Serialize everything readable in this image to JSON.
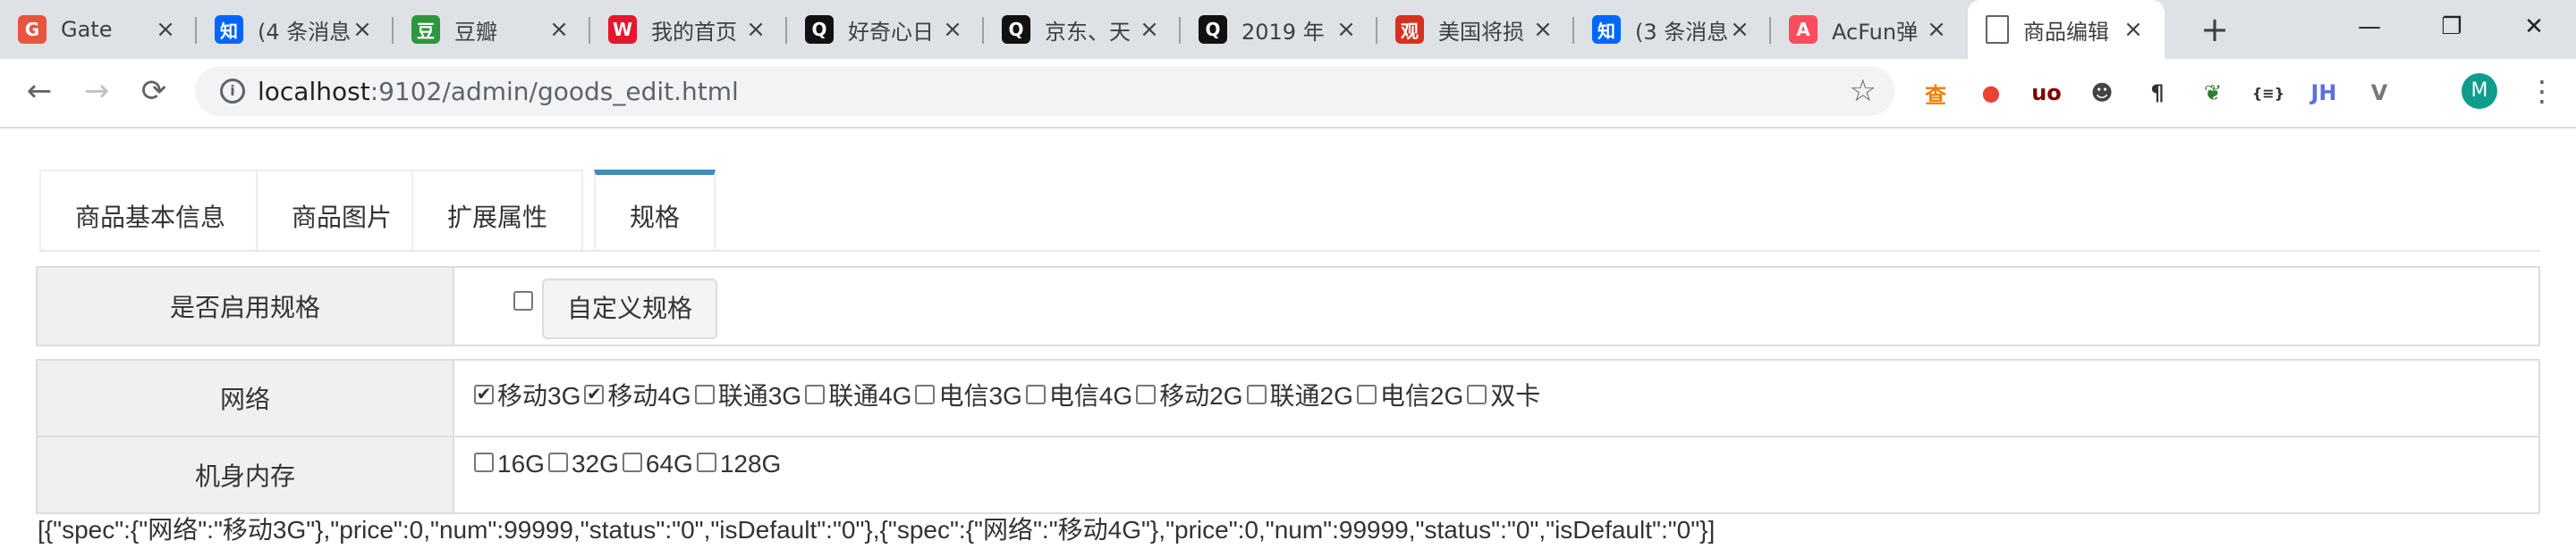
{
  "browser": {
    "tabs": [
      {
        "title": "Gate",
        "favicon": "gate-favicon",
        "color": "#e8543c",
        "glyph": "G"
      },
      {
        "title": "(4 条消息",
        "favicon": "zhihu-favicon",
        "color": "#0066ff",
        "glyph": "知"
      },
      {
        "title": "豆瓣",
        "favicon": "douban-favicon",
        "color": "#2e963d",
        "glyph": "豆"
      },
      {
        "title": "我的首页",
        "favicon": "weibo-favicon",
        "color": "#e6162d",
        "glyph": "W"
      },
      {
        "title": "好奇心日",
        "favicon": "qdaily-favicon",
        "color": "#111111",
        "glyph": "Q"
      },
      {
        "title": "京东、天",
        "favicon": "qdaily-favicon",
        "color": "#111111",
        "glyph": "Q"
      },
      {
        "title": "2019 年",
        "favicon": "qdaily-favicon",
        "color": "#111111",
        "glyph": "Q"
      },
      {
        "title": "美国将损",
        "favicon": "guancha-favicon",
        "color": "#d7301f",
        "glyph": "观"
      },
      {
        "title": "(3 条消息",
        "favicon": "zhihu-favicon",
        "color": "#0066ff",
        "glyph": "知"
      },
      {
        "title": "AcFun弹",
        "favicon": "acfun-favicon",
        "color": "#fd4c5d",
        "glyph": "A"
      },
      {
        "title": "商品编辑",
        "favicon": "page-favicon",
        "color": "#ffffff",
        "glyph": "▯",
        "active": true
      }
    ],
    "new_tab_label": "+",
    "window_controls": {
      "minimize": "—",
      "restore": "❐",
      "close": "✕"
    },
    "nav": {
      "back": "←",
      "forward": "→",
      "reload": "⟳"
    },
    "url_host": "localhost",
    "url_rest": ":9102/admin/goods_edit.html",
    "lock_glyph": "i",
    "bookmark_glyph": "☆",
    "extensions": [
      {
        "name": "ext-search-icon",
        "glyph": "查",
        "color": "#f57c00"
      },
      {
        "name": "ext-location-icon",
        "glyph": "●",
        "color": "#ea4335"
      },
      {
        "name": "ext-ublock-icon",
        "glyph": "uo",
        "color": "#800000"
      },
      {
        "name": "ext-spy-icon",
        "glyph": "☻",
        "color": "#444444"
      },
      {
        "name": "ext-pilcrow-icon",
        "glyph": "¶",
        "color": "#333333"
      },
      {
        "name": "ext-leaf-icon",
        "glyph": "❦",
        "color": "#2e7d32"
      },
      {
        "name": "ext-json-icon",
        "glyph": "{≡}",
        "color": "#333333"
      },
      {
        "name": "ext-jh-icon",
        "glyph": "JH",
        "color": "#5b6ee1"
      },
      {
        "name": "ext-vimium-icon",
        "glyph": "V",
        "color": "#777777"
      }
    ],
    "avatar_initial": "M",
    "menu_glyph": "⋮"
  },
  "page": {
    "tabs": [
      {
        "label": "商品基本信息",
        "active": false
      },
      {
        "label": "商品图片",
        "active": false
      },
      {
        "label": "扩展属性",
        "active": false
      },
      {
        "label": "规格",
        "active": true
      }
    ],
    "enable_spec": {
      "label": "是否启用规格",
      "checked": false,
      "custom_button": "自定义规格"
    },
    "network": {
      "label": "网络",
      "options": [
        {
          "text": "移动3G",
          "checked": true
        },
        {
          "text": "移动4G",
          "checked": true
        },
        {
          "text": "联通3G",
          "checked": false
        },
        {
          "text": "联通4G",
          "checked": false
        },
        {
          "text": "电信3G",
          "checked": false
        },
        {
          "text": "电信4G",
          "checked": false
        },
        {
          "text": "移动2G",
          "checked": false
        },
        {
          "text": "联通2G",
          "checked": false
        },
        {
          "text": "电信2G",
          "checked": false
        },
        {
          "text": "双卡",
          "checked": false
        }
      ]
    },
    "memory": {
      "label": "机身内存",
      "options": [
        {
          "text": "16G",
          "checked": false
        },
        {
          "text": "32G",
          "checked": false
        },
        {
          "text": "64G",
          "checked": false
        },
        {
          "text": "128G",
          "checked": false
        }
      ]
    },
    "json_output": "[{\"spec\":{\"网络\":\"移动3G\"},\"price\":0,\"num\":99999,\"status\":\"0\",\"isDefault\":\"0\"},{\"spec\":{\"网络\":\"移动4G\"},\"price\":0,\"num\":99999,\"status\":\"0\",\"isDefault\":\"0\"}]"
  }
}
